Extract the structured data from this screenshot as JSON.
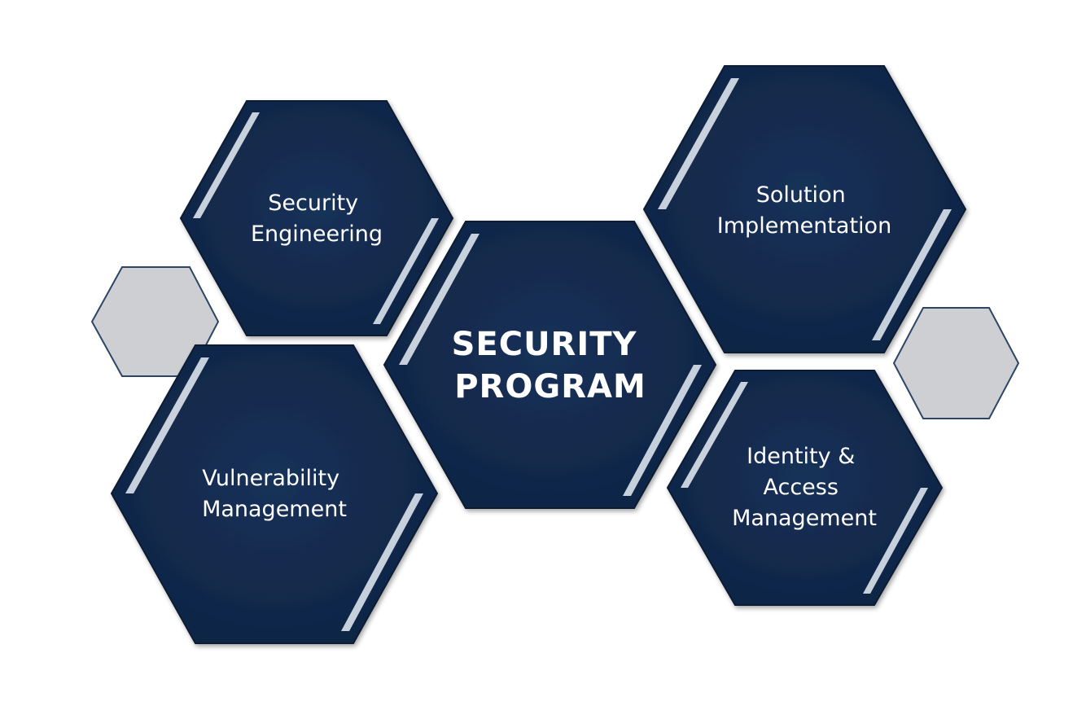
{
  "diagram": {
    "center": {
      "lines": [
        "SECURITY",
        "PROGRAM"
      ]
    },
    "nodes": [
      {
        "id": "security-engineering",
        "lines": [
          "Security",
          "Engineering"
        ]
      },
      {
        "id": "solution-implementation",
        "lines": [
          "Solution",
          "Implementation"
        ]
      },
      {
        "id": "vulnerability-management",
        "lines": [
          "Vulnerability",
          "Management"
        ]
      },
      {
        "id": "identity-access-management",
        "lines": [
          "Identity &",
          "Access",
          "Management"
        ]
      }
    ],
    "decorations": [
      "left-accent",
      "right-accent"
    ]
  },
  "colors": {
    "hex_fill": "#12294a",
    "hex_border": "#0b1a30",
    "hex_highlight": "#e8eef6",
    "accent_fill": "#cdcfd3",
    "accent_border": "#2d4566",
    "text": "#ffffff"
  }
}
